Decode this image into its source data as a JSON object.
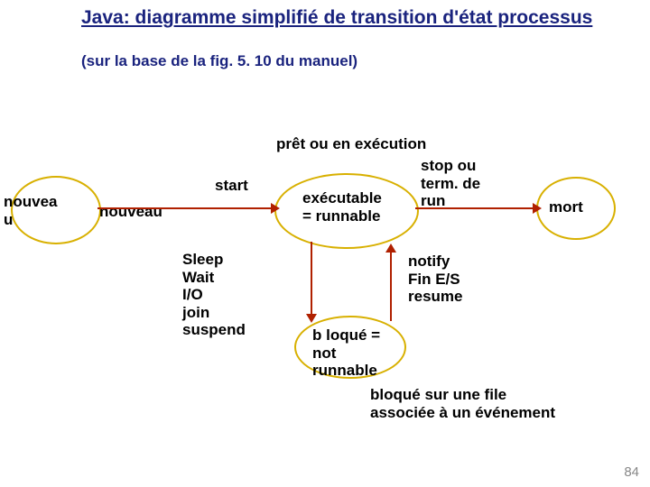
{
  "title": "Java: diagramme simplifié de transition d'état processus",
  "subtitle": "(sur la base de la fig. 5. 10 du manuel)",
  "caption": "prêt ou en exécution",
  "states": {
    "nouveau_outer": "nouvea\nu",
    "nouveau_inner": "nouveau",
    "executable": "exécutable\n= runnable",
    "bloque": "b loqué =\nnot\nrunnable",
    "mort": "mort"
  },
  "transitions": {
    "start": "start",
    "stop": "stop ou\nterm. de\nrun",
    "block": "Sleep\nWait\nI/O\njoin\nsuspend",
    "unblock": "notify\nFin E/S\nresume"
  },
  "footnote": "bloqué sur une file\nassociée à un événement",
  "page": "84"
}
